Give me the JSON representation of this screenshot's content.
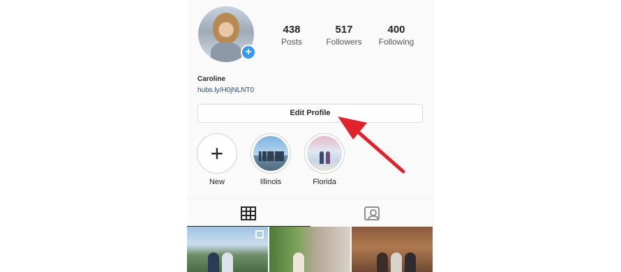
{
  "profile": {
    "name": "Caroline",
    "link": "hubs.ly/H0jNLNT0",
    "add_icon": "+"
  },
  "stats": {
    "posts": {
      "value": "438",
      "label": "Posts"
    },
    "followers": {
      "value": "517",
      "label": "Followers"
    },
    "following": {
      "value": "400",
      "label": "Following"
    }
  },
  "actions": {
    "edit_profile": "Edit Profile"
  },
  "highlights": [
    {
      "label": "New",
      "icon": "+"
    },
    {
      "label": "Illinois"
    },
    {
      "label": "Florida"
    }
  ],
  "tabs": {
    "grid": "grid-icon",
    "tagged": "tagged-icon"
  },
  "colors": {
    "accent_blue": "#3897f0",
    "annotation_arrow": "#e0232b"
  }
}
